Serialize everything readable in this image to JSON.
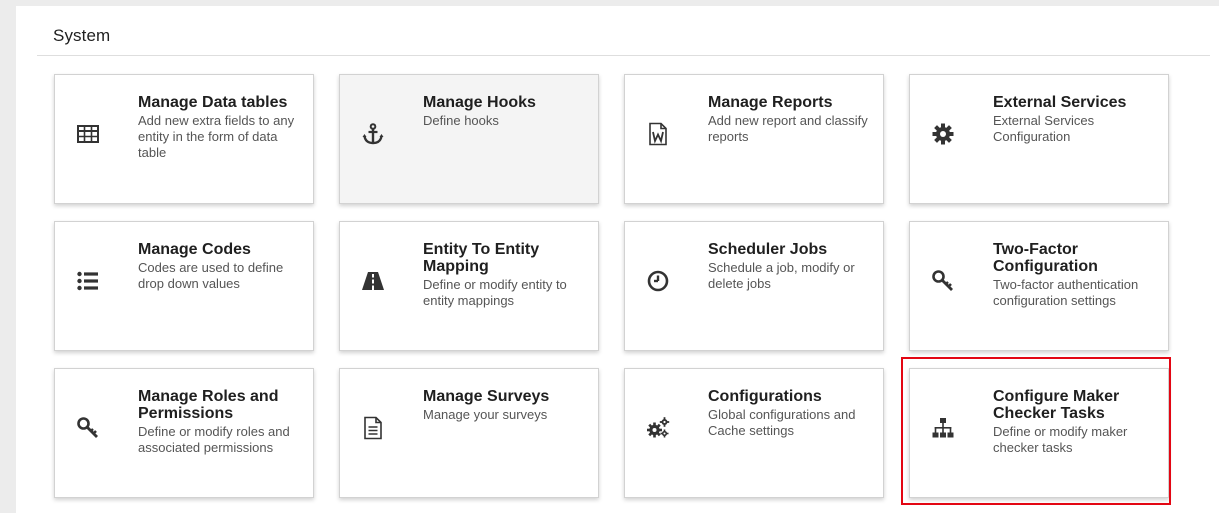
{
  "section": {
    "title": "System"
  },
  "cards": [
    {
      "title": "Manage Data tables",
      "desc": "Add new extra fields to any entity in the form of data table",
      "icon": "table-icon"
    },
    {
      "title": "Manage Hooks",
      "desc": "Define hooks",
      "icon": "anchor-icon"
    },
    {
      "title": "Manage Reports",
      "desc": "Add new report and classify reports",
      "icon": "word-file-icon"
    },
    {
      "title": "External Services",
      "desc": "External Services Configuration",
      "icon": "gear-icon"
    },
    {
      "title": "Manage Codes",
      "desc": "Codes are used to define drop down values",
      "icon": "list-icon"
    },
    {
      "title": "Entity To Entity Mapping",
      "desc": "Define or modify entity to entity mappings",
      "icon": "road-icon"
    },
    {
      "title": "Scheduler Jobs",
      "desc": "Schedule a job, modify or delete jobs",
      "icon": "clock-icon"
    },
    {
      "title": "Two-Factor Configuration",
      "desc": "Two-factor authentication configuration settings",
      "icon": "key-icon"
    },
    {
      "title": "Manage Roles and Permissions",
      "desc": "Define or modify roles and associated permissions",
      "icon": "key-icon"
    },
    {
      "title": "Manage Surveys",
      "desc": "Manage your surveys",
      "icon": "file-text-icon"
    },
    {
      "title": "Configurations",
      "desc": "Global configurations and Cache settings",
      "icon": "gears-icon"
    },
    {
      "title": "Configure Maker Checker Tasks",
      "desc": "Define or modify maker checker tasks",
      "icon": "sitemap-icon"
    }
  ],
  "state": {
    "hovered_card": "Manage Hooks",
    "highlighted_card": "Configure Maker Checker Tasks"
  },
  "colors": {
    "highlight": "#e30613",
    "icon": "#333333",
    "hover_bg": "#f4f4f4"
  }
}
